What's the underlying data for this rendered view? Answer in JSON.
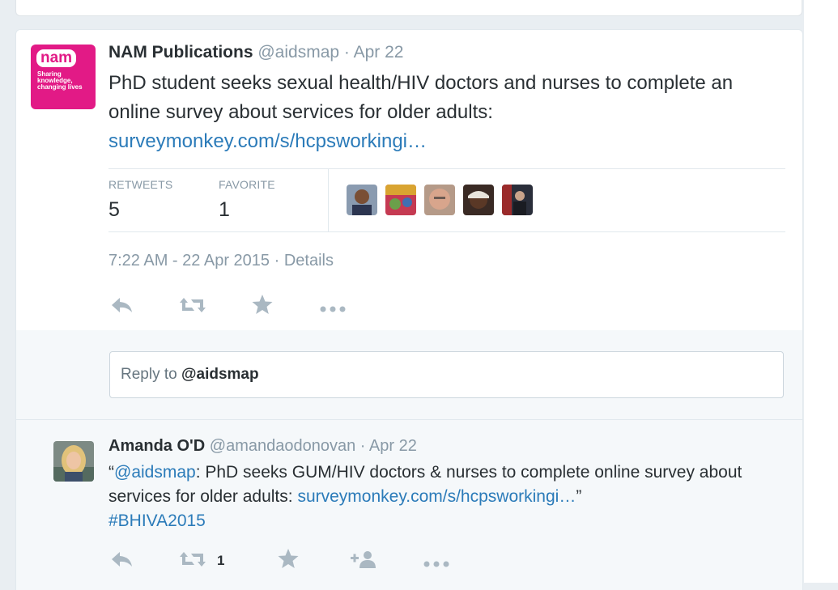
{
  "main_tweet": {
    "author_name": "NAM Publications",
    "handle": "@aidsmap",
    "date": "Apr 22",
    "logo_word": "nam",
    "logo_tagline": "Sharing knowledge, changing lives",
    "text": "PhD student seeks sexual health/HIV doctors and nurses to complete an online survey about services for older adults:",
    "link": "surveymonkey.com/s/hcpsworkingi…",
    "stats": {
      "retweets_label": "RETWEETS",
      "retweets_value": "5",
      "favorites_label": "FAVORITE",
      "favorites_value": "1"
    },
    "timestamp": "7:22 AM - 22 Apr 2015",
    "details_label": "Details",
    "actions": {
      "reply_icon": "reply-icon",
      "retweet_icon": "retweet-icon",
      "favorite_icon": "star-icon",
      "more_icon": "more-icon"
    }
  },
  "reply_box": {
    "prefix": "Reply to ",
    "mention": "@aidsmap"
  },
  "reply_tweet": {
    "author_name": "Amanda O'D",
    "handle": "@amandaodonovan",
    "date": "Apr 22",
    "quote_open": "“",
    "mention": "@aidsmap",
    "text_part": ": PhD seeks GUM/HIV doctors & nurses to complete online survey about services for older adults: ",
    "link": "surveymonkey.com/s/hcpsworkingi…",
    "quote_close": "”",
    "hashtag": "#BHIVA2015",
    "retweet_count": "1"
  },
  "colors": {
    "brand_pink": "#e21a86",
    "link_blue": "#2b7bb9",
    "muted_gray": "#8899a6",
    "icon_gray": "#aab8c2"
  }
}
